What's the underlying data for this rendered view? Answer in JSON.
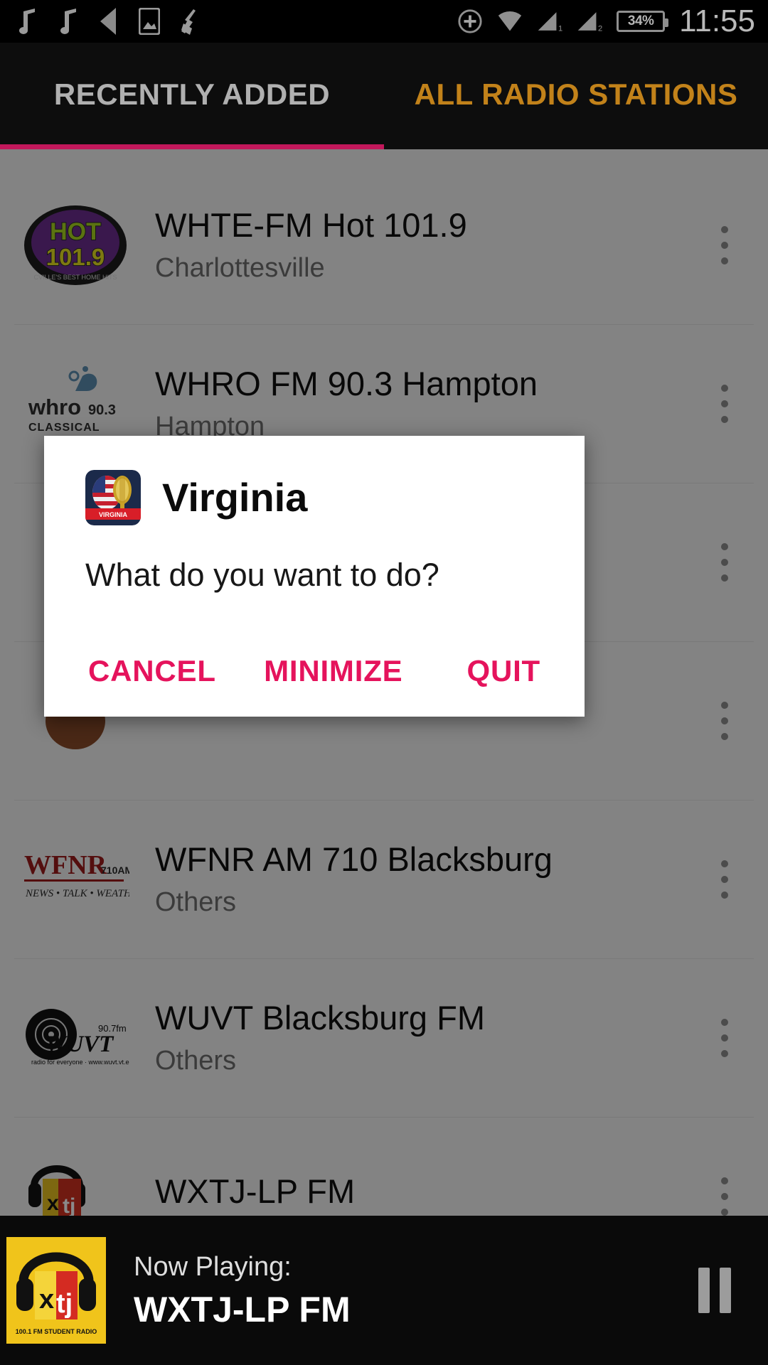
{
  "statusbar": {
    "time": "11:55",
    "battery_label": "34%",
    "icons_left": [
      "music-note-icon",
      "music-note-icon",
      "back-arrow-icon",
      "image-icon",
      "broom-icon"
    ],
    "icons_right": [
      "circle-plus-icon",
      "wifi-icon",
      "signal-1-icon",
      "signal-2-icon",
      "battery-icon"
    ],
    "signal_labels": [
      "1",
      "2"
    ]
  },
  "tabs": {
    "items": [
      {
        "label": "RECENTLY ADDED",
        "active": true
      },
      {
        "label": "ALL RADIO STATIONS",
        "active": false
      }
    ],
    "active_color": "#c2185b",
    "inactive_color": "#c2821a"
  },
  "list": {
    "rows": [
      {
        "title": "WHTE-FM Hot  101.9",
        "subtitle": "Charlottesville",
        "logo": "hot-1019-logo"
      },
      {
        "title": "WHRO FM 90.3 Hampton",
        "subtitle": "Hampton",
        "logo": "whro-classical-logo"
      },
      {
        "title": "",
        "subtitle": "",
        "logo": "hidden-logo"
      },
      {
        "title": "",
        "subtitle": "",
        "logo": "hidden-logo-2"
      },
      {
        "title": "WFNR AM 710 Blacksburg",
        "subtitle": "Others",
        "logo": "wfnr-logo"
      },
      {
        "title": "WUVT Blacksburg FM",
        "subtitle": "Others",
        "logo": "wuvt-logo"
      },
      {
        "title": "WXTJ-LP FM",
        "subtitle": "",
        "logo": "wxtj-logo"
      }
    ],
    "overflow_icon": "kebab-menu-icon"
  },
  "dialog": {
    "icon": "virginia-flag-microphone-icon",
    "icon_banner_text": "VIRGINIA",
    "title": "Virginia",
    "message": "What do you want to do?",
    "buttons": [
      {
        "label": "CANCEL",
        "name": "cancel"
      },
      {
        "label": "MINIMIZE",
        "name": "minimize"
      },
      {
        "label": "QUIT",
        "name": "quit"
      }
    ],
    "button_color": "#e5135c"
  },
  "now_playing": {
    "label": "Now Playing:",
    "station": "WXTJ-LP FM",
    "artwork": "wxtj-headphones-logo",
    "artwork_caption": "100.1 FM STUDENT RADIO",
    "control_icon": "pause-icon"
  }
}
